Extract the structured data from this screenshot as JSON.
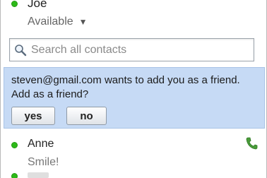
{
  "me": {
    "name": "Joe",
    "status": "Available",
    "status_caret": "▼"
  },
  "search": {
    "placeholder": "Search all contacts",
    "value": ""
  },
  "friend_request": {
    "message": "steven@gmail.com wants to add you as a friend.  Add as a friend?",
    "yes_label": "yes",
    "no_label": "no"
  },
  "contacts": [
    {
      "name": "Anne",
      "status": "Smile!",
      "presence": "online"
    }
  ],
  "colors": {
    "online": "#2cba18",
    "request_background": "#c6daf5",
    "phone_icon": "#4a9b3a"
  }
}
